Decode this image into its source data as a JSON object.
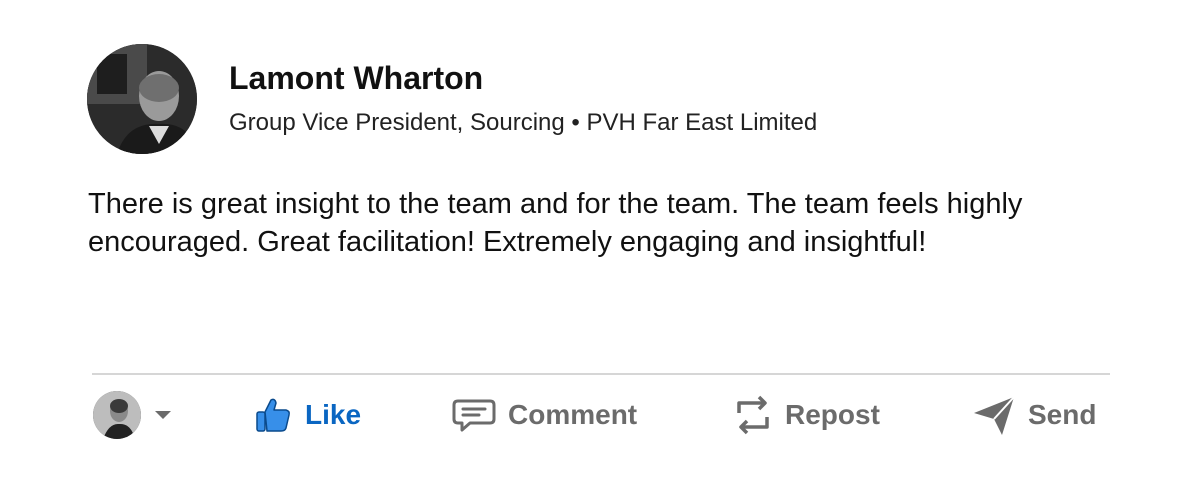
{
  "post": {
    "author": {
      "name": "Lamont Wharton",
      "headline": "Group Vice President, Sourcing • PVH Far East Limited"
    },
    "body": "There is great insight to the team and for the team. The team feels highly encouraged. Great facilitation! Extremely engaging and insightful!"
  },
  "actions": {
    "like": "Like",
    "comment": "Comment",
    "repost": "Repost",
    "send": "Send"
  },
  "icons": {
    "like": "thumbs-up-icon",
    "comment": "comment-icon",
    "repost": "repost-icon",
    "send": "send-icon",
    "reactor_caret": "caret-down-icon"
  },
  "colors": {
    "accent": "#0a66c2",
    "action_text": "#6b6b6b",
    "divider": "#d6d6d6"
  }
}
